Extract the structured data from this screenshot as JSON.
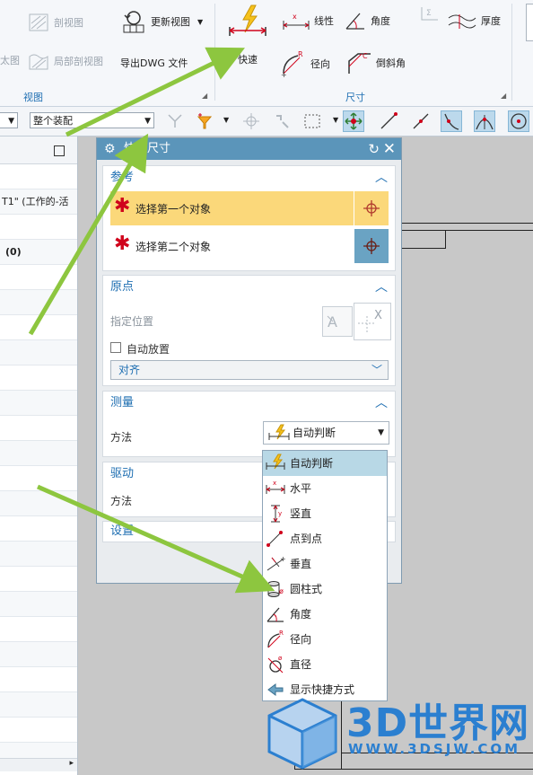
{
  "ribbon": {
    "view_group": {
      "label": "视图",
      "section_view": "剖视图",
      "break_view": "太图",
      "local_section": "局部剖视图",
      "update_views": "更新视图",
      "export_dwg": "导出DWG 文件"
    },
    "dimension_group": {
      "label": "尺寸",
      "rapid": "快速",
      "linear": "线性",
      "angular": "角度",
      "thickness": "厚度",
      "radial": "径向",
      "chamfer": "倒斜角"
    }
  },
  "selection_bar": {
    "scope_value": "整个装配"
  },
  "navigator": {
    "rows": [
      "",
      "T1\" (工作的-活",
      "",
      "(0)",
      "",
      "",
      "",
      "",
      "",
      "",
      "",
      "",
      "",
      "",
      "",
      "",
      "",
      "",
      "",
      "",
      "",
      "",
      "",
      ""
    ]
  },
  "dialog": {
    "title": "快速尺寸",
    "references": {
      "header": "参考",
      "first_object": "选择第一个对象",
      "second_object": "选择第二个对象"
    },
    "origin": {
      "header": "原点",
      "specify_location": "指定位置",
      "auto_place_label": "自动放置",
      "auto_place_checked": false,
      "align_value": "对齐"
    },
    "measurement": {
      "header": "测量",
      "method_label": "方法",
      "method_value": "自动判断"
    },
    "driving": {
      "header": "驱动",
      "method_label": "方法"
    },
    "settings": {
      "header": "设置"
    }
  },
  "method_options": [
    {
      "label": "自动判断",
      "icon": "rapid-dimension-icon",
      "selected": true
    },
    {
      "label": "水平",
      "icon": "horizontal-dimension-icon",
      "selected": false
    },
    {
      "label": "竖直",
      "icon": "vertical-dimension-icon",
      "selected": false
    },
    {
      "label": "点到点",
      "icon": "point-to-point-icon",
      "selected": false
    },
    {
      "label": "垂直",
      "icon": "perpendicular-icon",
      "selected": false
    },
    {
      "label": "圆柱式",
      "icon": "cylindrical-icon",
      "selected": false
    },
    {
      "label": "角度",
      "icon": "angular-icon",
      "selected": false
    },
    {
      "label": "径向",
      "icon": "radial-icon",
      "selected": false
    },
    {
      "label": "直径",
      "icon": "diameter-icon",
      "selected": false
    },
    {
      "label": "显示快捷方式",
      "icon": "show-shortcuts-icon",
      "selected": false
    }
  ],
  "watermark": {
    "brand": "3D世界网",
    "url": "WWW.3DSJW.COM"
  },
  "colors": {
    "dialog_title_bg": "#5b95ba",
    "accent_blue": "#1f6fb2",
    "selection_highlight": "#fbd87a",
    "required_star": "#d0021b",
    "annotation_arrow": "#8dc63f"
  }
}
